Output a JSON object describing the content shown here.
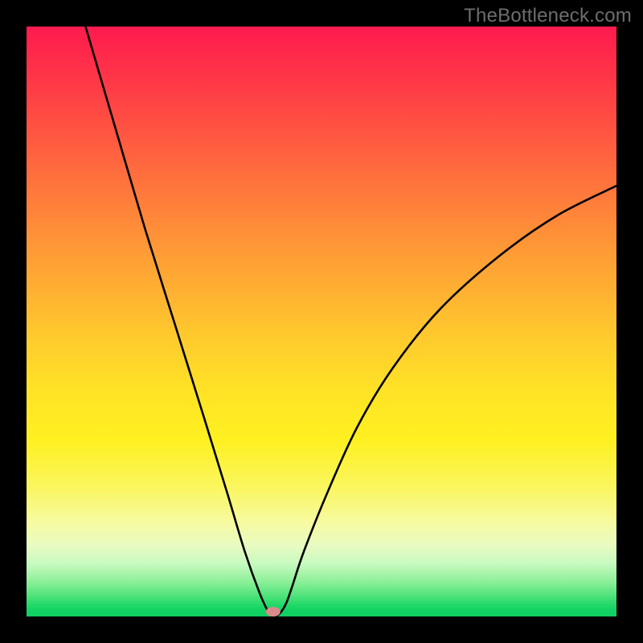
{
  "watermark": "TheBottleneck.com",
  "marker": {
    "fill": "#d98b8b",
    "x_norm": 0.418,
    "y_norm": 0.992,
    "rx": 9,
    "ry": 6
  },
  "curve": {
    "stroke": "#000000",
    "stroke_width": 2.6
  },
  "chart_data": {
    "type": "line",
    "title": "",
    "xlabel": "",
    "ylabel": "",
    "xlim": [
      0,
      1
    ],
    "ylim": [
      0,
      1
    ],
    "note": "V-shaped bottleneck curve on a red→green vertical gradient; minimum near x≈0.42 at y≈0. Left branch rises steeply toward y≈1 at x≈0.10; right branch rises to y≈0.73 at x=1.",
    "series": [
      {
        "name": "bottleneck-curve",
        "x": [
          0.1,
          0.15,
          0.2,
          0.25,
          0.3,
          0.34,
          0.37,
          0.395,
          0.41,
          0.42,
          0.43,
          0.44,
          0.45,
          0.47,
          0.51,
          0.56,
          0.62,
          0.7,
          0.8,
          0.9,
          1.0
        ],
        "y": [
          1.0,
          0.83,
          0.66,
          0.5,
          0.34,
          0.21,
          0.11,
          0.04,
          0.008,
          0.0,
          0.006,
          0.022,
          0.05,
          0.11,
          0.21,
          0.32,
          0.42,
          0.52,
          0.61,
          0.68,
          0.73
        ]
      }
    ],
    "marker_point": {
      "x": 0.418,
      "y": 0.008
    }
  }
}
